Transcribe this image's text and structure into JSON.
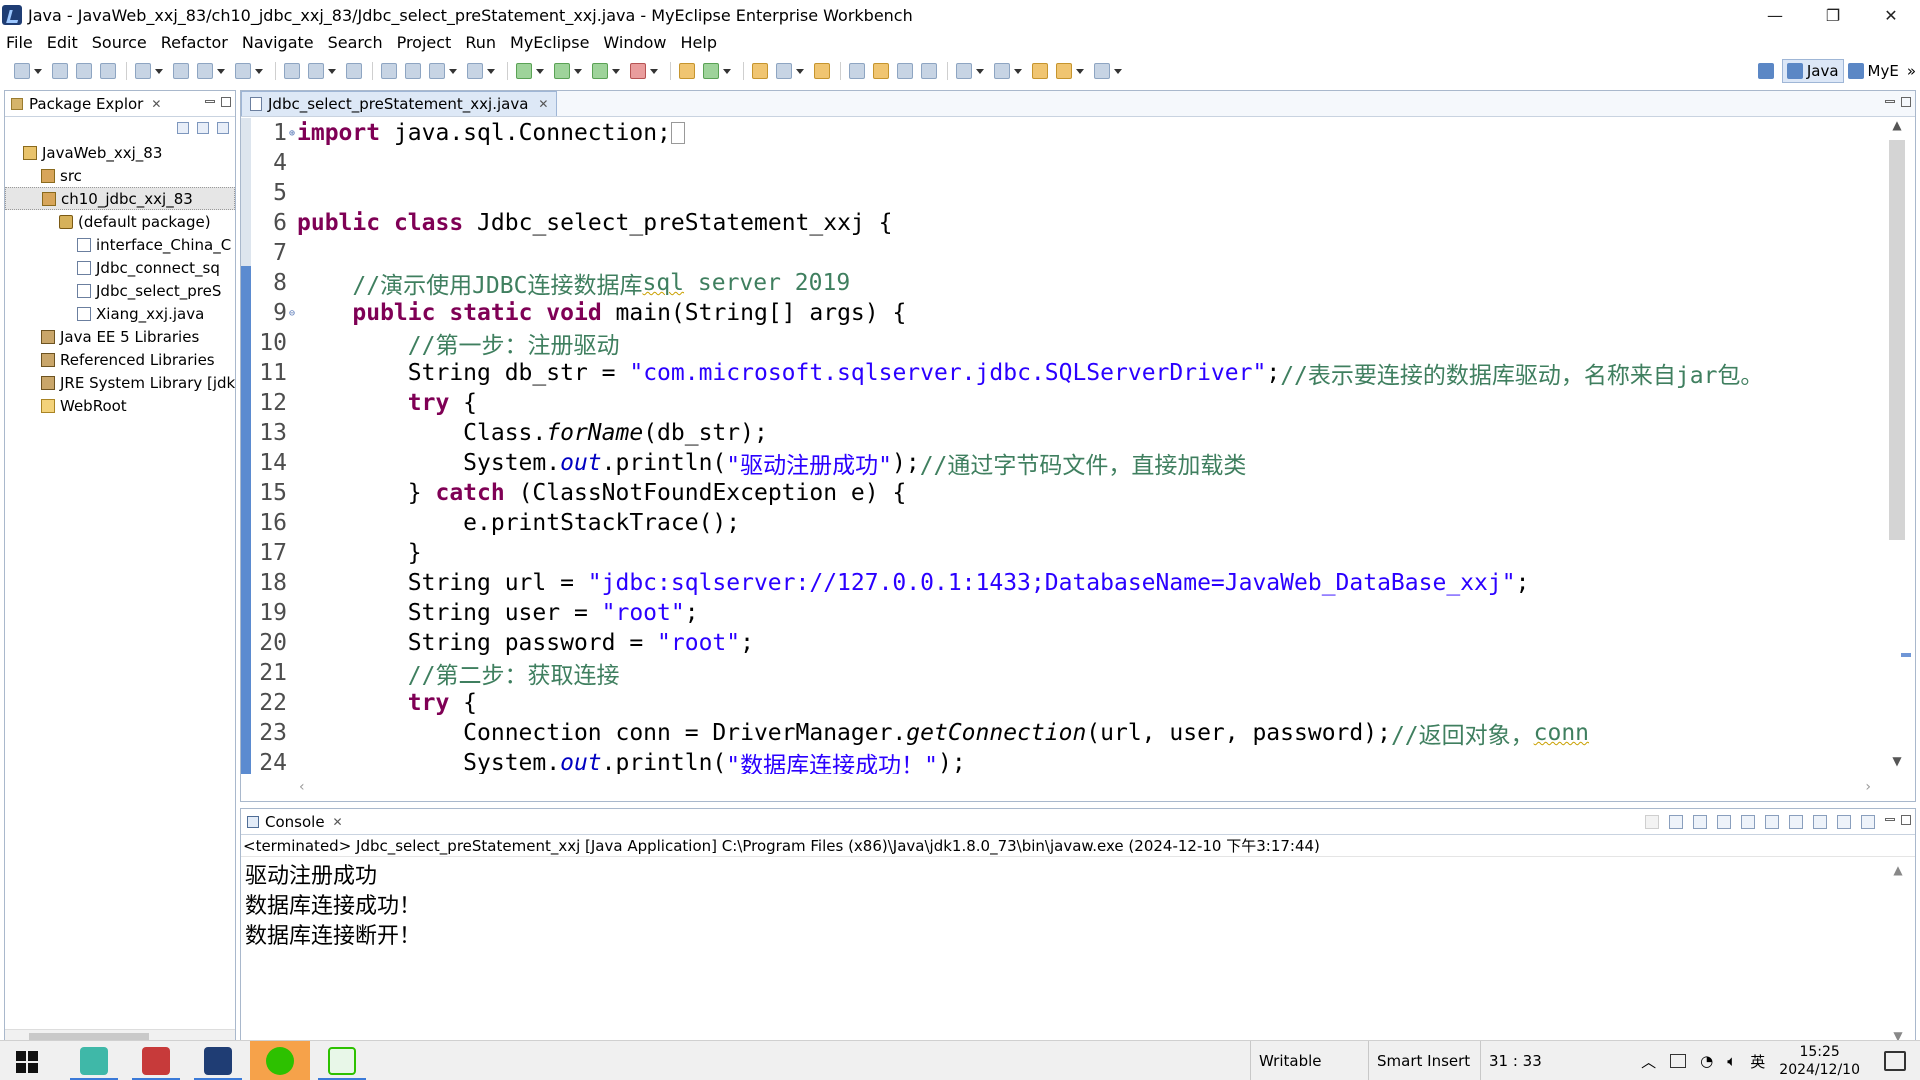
{
  "window": {
    "title": "Java - JavaWeb_xxj_83/ch10_jdbc_xxj_83/Jdbc_select_preStatement_xxj.java - MyEclipse Enterprise Workbench",
    "controls": {
      "minimize": "—",
      "restore": "❐",
      "close": "✕"
    }
  },
  "menu": [
    "File",
    "Edit",
    "Source",
    "Refactor",
    "Navigate",
    "Search",
    "Project",
    "Run",
    "MyEclipse",
    "Window",
    "Help"
  ],
  "perspectives": {
    "java": "Java",
    "myeclipse": "MyE",
    "more": "»"
  },
  "package_explorer": {
    "title": "Package Explor",
    "tree": [
      {
        "label": "JavaWeb_xxj_83",
        "icon": "project-icon",
        "indent": 1
      },
      {
        "label": "src",
        "icon": "source-folder-icon",
        "indent": 2
      },
      {
        "label": "ch10_jdbc_xxj_83",
        "icon": "source-folder-icon",
        "indent": 2,
        "selected": true
      },
      {
        "label": "(default package)",
        "icon": "package-icon",
        "indent": 3
      },
      {
        "label": "interface_China_C",
        "icon": "java-file-icon",
        "indent": 4
      },
      {
        "label": "Jdbc_connect_sq",
        "icon": "java-file-icon",
        "indent": 4
      },
      {
        "label": "Jdbc_select_preS",
        "icon": "java-file-icon",
        "indent": 4
      },
      {
        "label": "Xiang_xxj.java",
        "icon": "java-file-icon",
        "indent": 4
      },
      {
        "label": "Java EE 5 Libraries",
        "icon": "library-icon",
        "indent": 2
      },
      {
        "label": "Referenced Libraries",
        "icon": "library-icon",
        "indent": 2
      },
      {
        "label": "JRE System Library [jdk",
        "icon": "library-icon",
        "indent": 2
      },
      {
        "label": "WebRoot",
        "icon": "folder-icon",
        "indent": 2
      }
    ]
  },
  "editor": {
    "tab_label": "Jdbc_select_preStatement_xxj.java",
    "lines": [
      {
        "n": "1",
        "fold": "+",
        "segs": [
          {
            "t": "import",
            "c": "kw"
          },
          {
            "t": " java.sql.Connection;"
          }
        ],
        "cursor": true
      },
      {
        "n": "4",
        "segs": []
      },
      {
        "n": "5",
        "segs": []
      },
      {
        "n": "6",
        "segs": [
          {
            "t": "public",
            "c": "kw"
          },
          {
            "t": " "
          },
          {
            "t": "class",
            "c": "kw"
          },
          {
            "t": " Jdbc_select_preStatement_xxj {"
          }
        ]
      },
      {
        "n": "7",
        "segs": []
      },
      {
        "n": "8",
        "segs": [
          {
            "t": "    "
          },
          {
            "t": "//演示使用JDBC连接数据库",
            "c": "cm"
          },
          {
            "t": "sql",
            "c": "cm squig"
          },
          {
            "t": " server 2019",
            "c": "cm"
          }
        ]
      },
      {
        "n": "9",
        "fold": "-",
        "segs": [
          {
            "t": "    "
          },
          {
            "t": "public",
            "c": "kw"
          },
          {
            "t": " "
          },
          {
            "t": "static",
            "c": "kw"
          },
          {
            "t": " "
          },
          {
            "t": "void",
            "c": "kw"
          },
          {
            "t": " main(String[] args) {"
          }
        ]
      },
      {
        "n": "10",
        "segs": [
          {
            "t": "        "
          },
          {
            "t": "//第一步：注册驱动",
            "c": "cm"
          }
        ]
      },
      {
        "n": "11",
        "segs": [
          {
            "t": "        String db_str = "
          },
          {
            "t": "\"com.microsoft.sqlserver.jdbc.SQLServerDriver\"",
            "c": "str"
          },
          {
            "t": ";"
          },
          {
            "t": "//表示要连接的数据库驱动，名称来自jar包。",
            "c": "cm"
          }
        ]
      },
      {
        "n": "12",
        "segs": [
          {
            "t": "        "
          },
          {
            "t": "try",
            "c": "kw"
          },
          {
            "t": " {"
          }
        ]
      },
      {
        "n": "13",
        "segs": [
          {
            "t": "            Class."
          },
          {
            "t": "forName",
            "c": "it"
          },
          {
            "t": "(db_str);"
          }
        ]
      },
      {
        "n": "14",
        "segs": [
          {
            "t": "            System."
          },
          {
            "t": "out",
            "c": "fld"
          },
          {
            "t": ".println("
          },
          {
            "t": "\"驱动注册成功\"",
            "c": "str"
          },
          {
            "t": ");"
          },
          {
            "t": "//通过字节码文件，直接加载类",
            "c": "cm"
          }
        ]
      },
      {
        "n": "15",
        "segs": [
          {
            "t": "        } "
          },
          {
            "t": "catch",
            "c": "kw"
          },
          {
            "t": " (ClassNotFoundException e) {"
          }
        ]
      },
      {
        "n": "16",
        "segs": [
          {
            "t": "            e.printStackTrace();"
          }
        ]
      },
      {
        "n": "17",
        "segs": [
          {
            "t": "        }"
          }
        ]
      },
      {
        "n": "18",
        "segs": [
          {
            "t": "        String url = "
          },
          {
            "t": "\"jdbc:sqlserver://127.0.0.1:1433;DatabaseName=JavaWeb_DataBase_xxj\"",
            "c": "str"
          },
          {
            "t": ";"
          }
        ]
      },
      {
        "n": "19",
        "segs": [
          {
            "t": "        String user = "
          },
          {
            "t": "\"root\"",
            "c": "str"
          },
          {
            "t": ";"
          }
        ]
      },
      {
        "n": "20",
        "segs": [
          {
            "t": "        String password = "
          },
          {
            "t": "\"root\"",
            "c": "str"
          },
          {
            "t": ";"
          }
        ]
      },
      {
        "n": "21",
        "segs": [
          {
            "t": "        "
          },
          {
            "t": "//第二步：获取连接",
            "c": "cm"
          }
        ]
      },
      {
        "n": "22",
        "segs": [
          {
            "t": "        "
          },
          {
            "t": "try",
            "c": "kw"
          },
          {
            "t": " {"
          }
        ]
      },
      {
        "n": "23",
        "segs": [
          {
            "t": "            Connection conn = DriverManager."
          },
          {
            "t": "getConnection",
            "c": "it"
          },
          {
            "t": "(url, user, password);"
          },
          {
            "t": "//返回对象，",
            "c": "cm"
          },
          {
            "t": "conn",
            "c": "cm squig"
          }
        ]
      },
      {
        "n": "24",
        "segs": [
          {
            "t": "            System."
          },
          {
            "t": "out",
            "c": "fld"
          },
          {
            "t": ".println("
          },
          {
            "t": "\"数据库连接成功！\"",
            "c": "str"
          },
          {
            "t": ");"
          }
        ]
      }
    ]
  },
  "console": {
    "tab_label": "Console",
    "terminated": "<terminated> Jdbc_select_preStatement_xxj [Java Application] C:\\Program Files (x86)\\Java\\jdk1.8.0_73\\bin\\javaw.exe (2024-12-10 下午3:17:44)",
    "output": [
      "驱动注册成功",
      "数据库连接成功！",
      "数据库连接断开！"
    ]
  },
  "status": {
    "writable": "Writable",
    "insert_mode": "Smart Insert",
    "position": "31 : 33"
  },
  "tray": {
    "ime": "英",
    "time": "15:25",
    "date": "2024/12/10"
  }
}
